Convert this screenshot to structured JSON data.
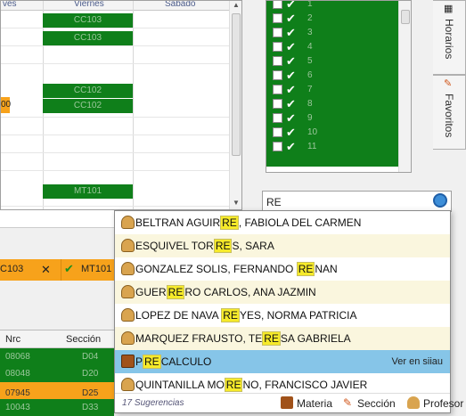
{
  "grid": {
    "headers": [
      "ves",
      "Viernes",
      "Sabado"
    ],
    "cells": [
      "CC103",
      "CC103",
      "CC102",
      "CC102",
      "MT101"
    ],
    "orange_cell": "00"
  },
  "chips": [
    {
      "label": "C103",
      "remove_icon": "close-icon"
    },
    {
      "label": "MT101",
      "check_icon": "check-icon"
    }
  ],
  "bottom_table": {
    "headers": [
      "Nrc",
      "Sección"
    ],
    "rows": [
      {
        "nrc": "08068",
        "seccion": "D04",
        "status": "green"
      },
      {
        "nrc": "08048",
        "seccion": "D20",
        "status": "green"
      },
      {
        "nrc": "07945",
        "seccion": "D25",
        "status": "orange"
      },
      {
        "nrc": "10043",
        "seccion": "D33",
        "status": "green"
      }
    ]
  },
  "horarios_list": [
    "1",
    "2",
    "3",
    "4",
    "5",
    "6",
    "7",
    "8",
    "9",
    "10",
    "11"
  ],
  "tabs": [
    {
      "label": "Horarios",
      "icon": "calendar-icon"
    },
    {
      "label": "Favoritos",
      "icon": "pencil-icon"
    }
  ],
  "search": {
    "value": "RE",
    "icon": "search-icon"
  },
  "suggestions": [
    {
      "pre": "BELTRAN AGUIR",
      "hl": "RE",
      "post": ", FABIOLA DEL CARMEN",
      "type": "profesor"
    },
    {
      "pre": "ESQUIVEL TOR",
      "hl": "RE",
      "post": "S, SARA",
      "type": "profesor"
    },
    {
      "pre": "GONZALEZ SOLIS, FERNANDO ",
      "hl": "RE",
      "post": "NAN",
      "type": "profesor"
    },
    {
      "pre": "GUER",
      "hl": "RE",
      "post": "RO CARLOS, ANA JAZMIN",
      "type": "profesor"
    },
    {
      "pre": "LOPEZ DE NAVA ",
      "hl": "RE",
      "post": "YES, NORMA PATRICIA",
      "type": "profesor"
    },
    {
      "pre": "MARQUEZ FRAUSTO, TE",
      "hl": "RE",
      "post": "SA GABRIELA",
      "type": "profesor"
    },
    {
      "pre": "P",
      "hl": "RE",
      "post": "CALCULO",
      "type": "materia",
      "action": "Ver en siiau"
    },
    {
      "pre": "QUINTANILLA MO",
      "hl": "RE",
      "post": "NO, FRANCISCO JAVIER",
      "type": "profesor"
    }
  ],
  "footer": {
    "count": "17 Sugerencias",
    "materia": "Materia",
    "seccion": "Sección",
    "profesor": "Profesor"
  }
}
